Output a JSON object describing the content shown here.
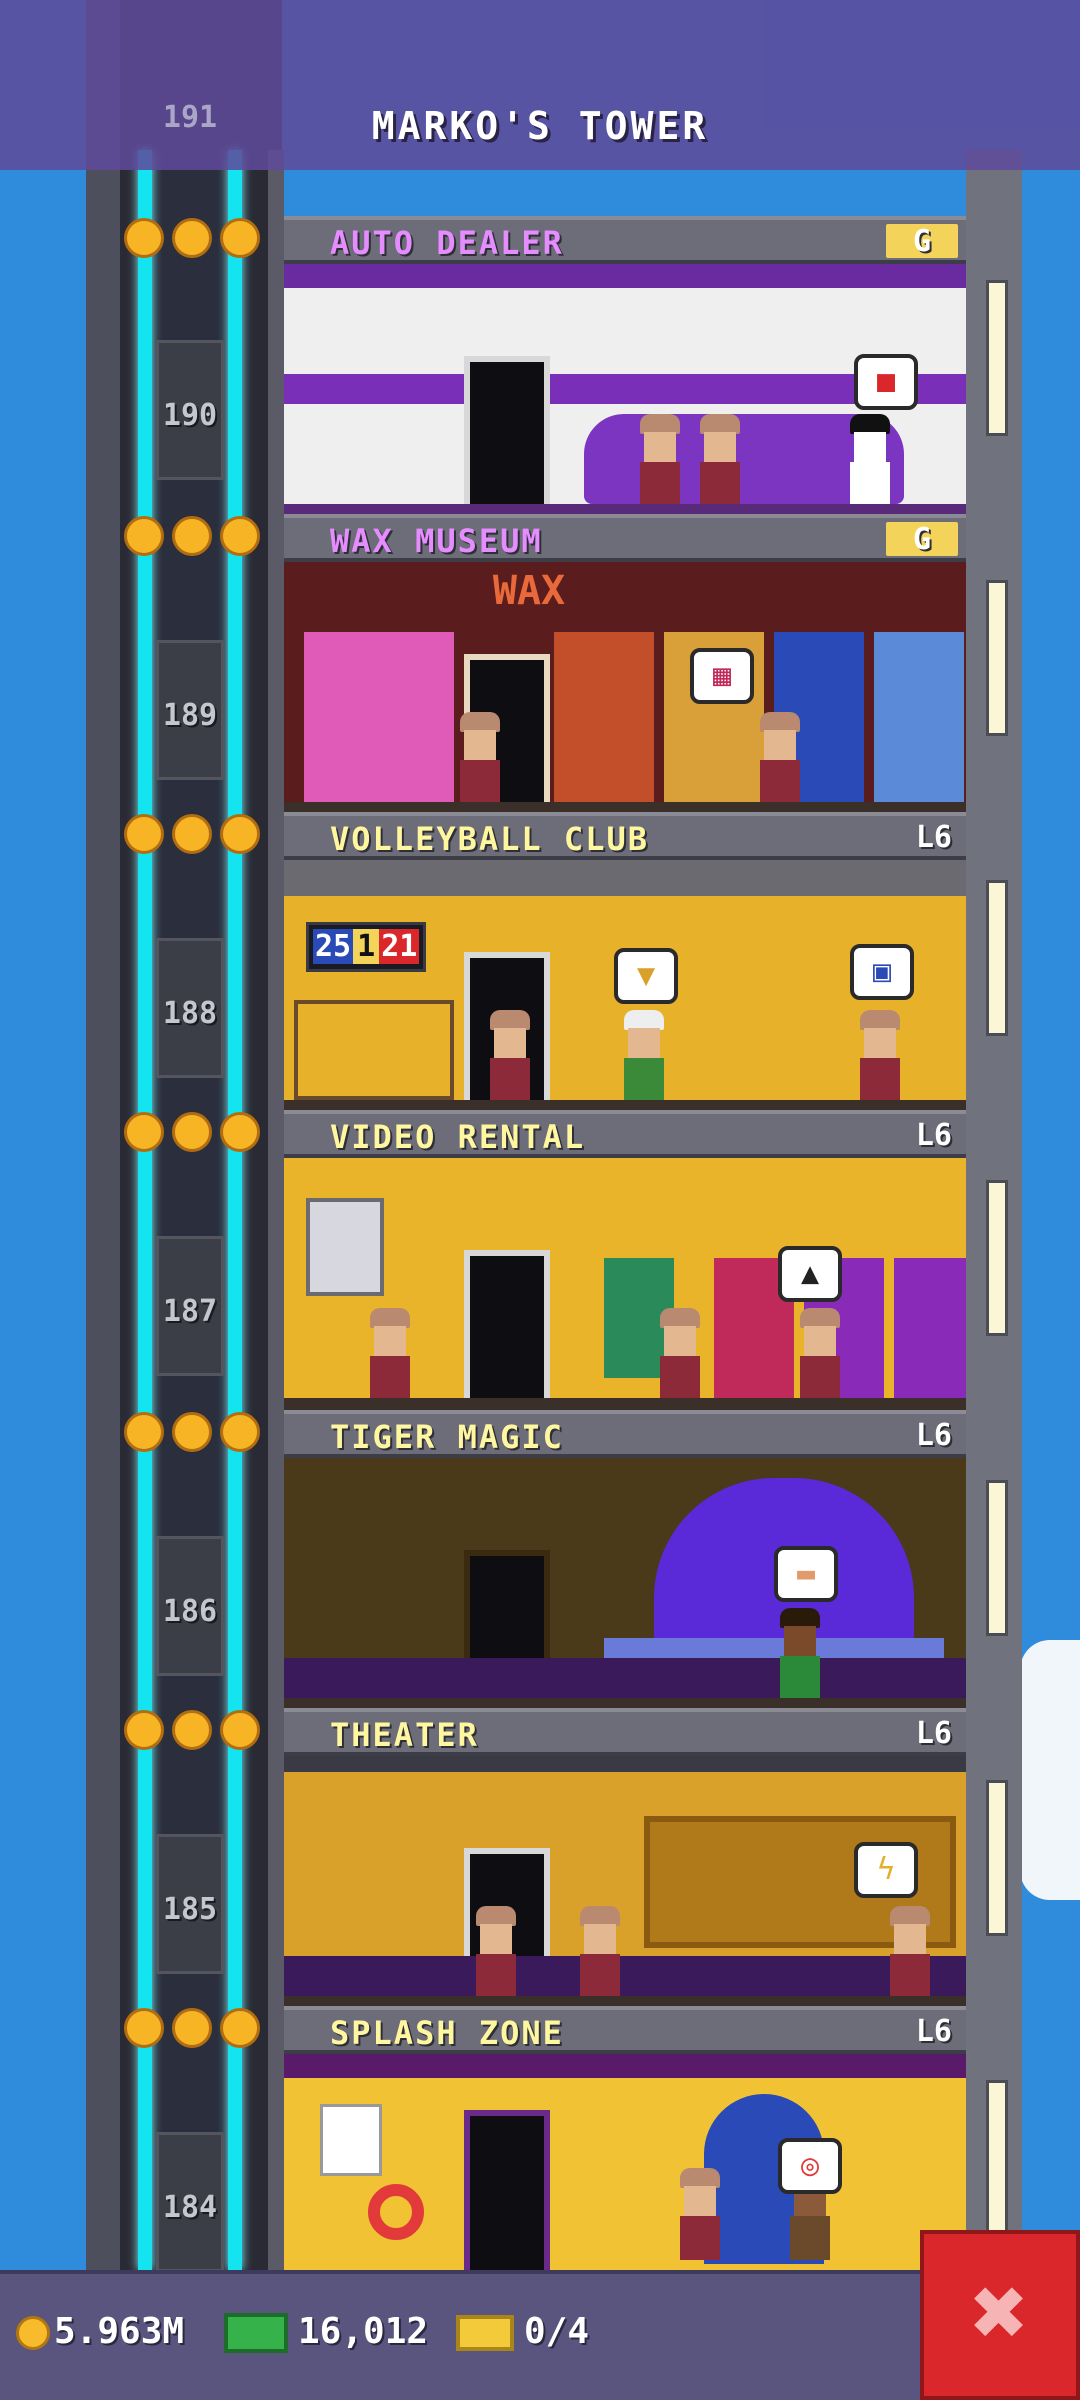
{
  "header": {
    "title": "MARKO'S TOWER",
    "top_floor_number": "191"
  },
  "floors": [
    {
      "name": "AUTO DEALER",
      "badge": "G",
      "number": "190"
    },
    {
      "name": "WAX MUSEUM",
      "badge": "G",
      "number": "189"
    },
    {
      "name": "VOLLEYBALL CLUB",
      "badge": "L6",
      "number": "188"
    },
    {
      "name": "VIDEO RENTAL",
      "badge": "L6",
      "number": "187"
    },
    {
      "name": "TIGER MAGIC",
      "badge": "L6",
      "number": "186"
    },
    {
      "name": "THEATER",
      "badge": "L6",
      "number": "185"
    },
    {
      "name": "SPLASH ZONE",
      "badge": "L6",
      "number": "184"
    }
  ],
  "room_signs": {
    "wax_sign": "WAX",
    "scoreboard_left": "25",
    "scoreboard_mid": "1",
    "scoreboard_right": "21"
  },
  "stars_per_floor": 3,
  "status": {
    "coins": "5.963M",
    "bux": "16,012",
    "tickets": "0/4"
  },
  "icons": {
    "coins": "coin-icon",
    "bux": "tower-bux-icon",
    "tickets": "ticket-icon",
    "close": "close-icon"
  },
  "colors": {
    "sky": "#2f8cdc",
    "elevator_rail": "#14e3f0",
    "label_text": "#fff7a0",
    "close_button": "#d9272b",
    "bottom_bar": "#5a557e"
  }
}
